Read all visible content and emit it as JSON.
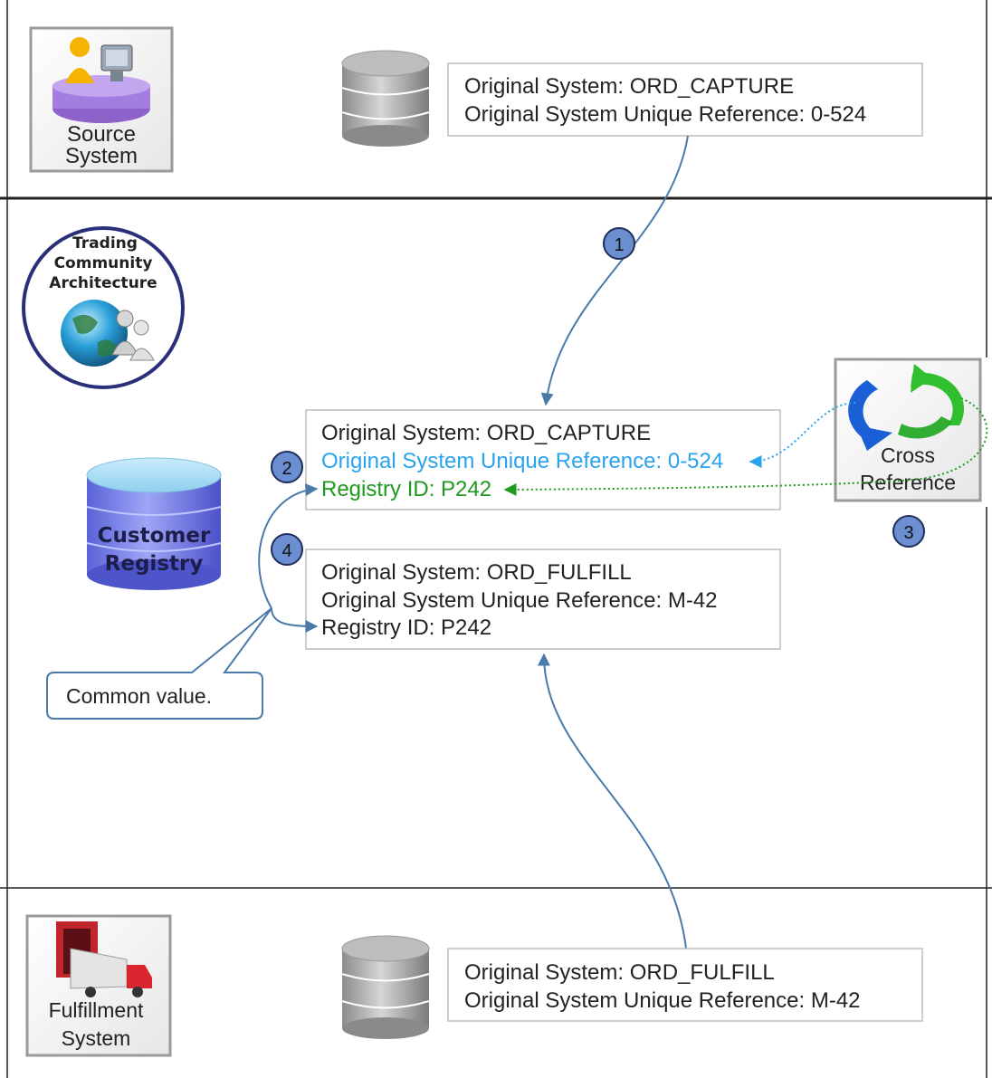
{
  "source": {
    "icon_label_line1": "Source",
    "icon_label_line2": "System",
    "record": {
      "line1": "Original System: ORD_CAPTURE",
      "line2": "Original System Unique  Reference:  0-524"
    }
  },
  "tca": {
    "badge_line1": "Trading",
    "badge_line2": "Community",
    "badge_line3": "Architecture",
    "registry_line1": "Customer",
    "registry_line2": "Registry",
    "capture_record": {
      "line1": "Original  System: ORD_CAPTURE",
      "line2": "Original System Unique  Reference:  0-524",
      "line3": "Registry ID:  P242"
    },
    "fulfill_record": {
      "line1": "Original  System: ORD_FULFILL",
      "line2": "Original System Unique  Reference:  M-42",
      "line3": "Registry ID:  P242"
    },
    "cross_ref_line1": "Cross",
    "cross_ref_line2": "Reference",
    "callout": "Common  value.",
    "steps": [
      "1",
      "2",
      "3",
      "4"
    ]
  },
  "fulfillment": {
    "icon_label_line1": "Fulfillment",
    "icon_label_line2": "System",
    "record": {
      "line1": "Original  System: ORD_FULFILL",
      "line2": "Original System Unique  Reference:  M-42"
    }
  },
  "colors": {
    "blue_text": "#2aa3ee",
    "green_text": "#1f9a1f",
    "arrow": "#4a7aa8",
    "step_fill": "#6b8fd0"
  }
}
